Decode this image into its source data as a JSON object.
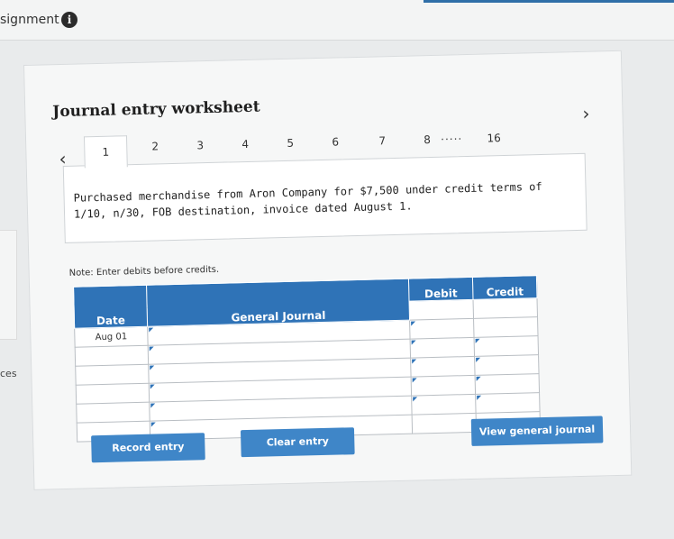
{
  "header": {
    "assignment_label": "signment",
    "info_icon": "i"
  },
  "side": {
    "label": "ces"
  },
  "worksheet": {
    "title": "Journal entry worksheet",
    "tabs": [
      "1",
      "2",
      "3",
      "4",
      "5",
      "6",
      "7",
      "8",
      "16"
    ],
    "tab_ellipsis": "·····",
    "active_tab": "1",
    "nav_prev": "‹",
    "nav_next": "›",
    "prompt": "Purchased merchandise from Aron Company for $7,500 under credit terms of 1/10, n/30, FOB destination, invoice dated August 1.",
    "note": "Note: Enter debits before credits.",
    "table": {
      "headers": {
        "date": "Date",
        "general_journal": "General Journal",
        "debit": "Debit",
        "credit": "Credit"
      },
      "rows": [
        {
          "date": "Aug 01",
          "general_journal": "",
          "debit": "",
          "credit": ""
        },
        {
          "date": "",
          "general_journal": "",
          "debit": "",
          "credit": ""
        },
        {
          "date": "",
          "general_journal": "",
          "debit": "",
          "credit": ""
        },
        {
          "date": "",
          "general_journal": "",
          "debit": "",
          "credit": ""
        },
        {
          "date": "",
          "general_journal": "",
          "debit": "",
          "credit": ""
        },
        {
          "date": "",
          "general_journal": "",
          "debit": "",
          "credit": ""
        }
      ]
    },
    "buttons": {
      "record": "Record entry",
      "clear": "Clear entry",
      "view": "View general journal"
    }
  }
}
